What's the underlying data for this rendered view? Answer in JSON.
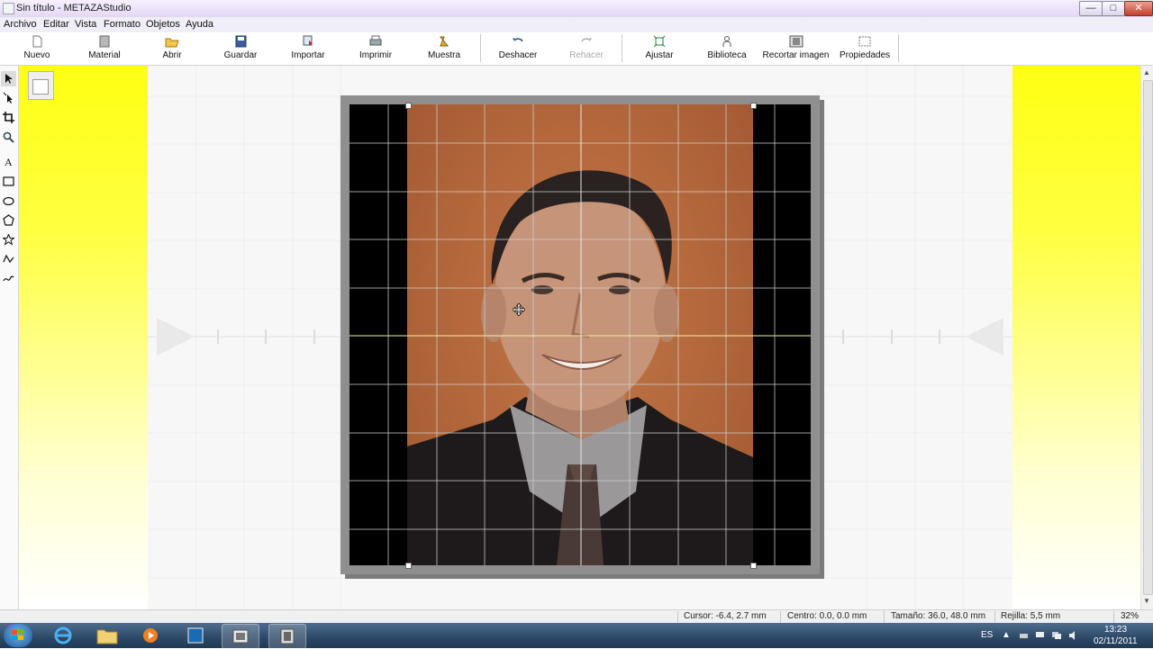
{
  "window": {
    "title": "Sin título - METAZAStudio",
    "min": "—",
    "max": "□",
    "close": "✕"
  },
  "menu": [
    "Archivo",
    "Editar",
    "Vista",
    "Formato",
    "Objetos",
    "Ayuda"
  ],
  "toolbar": {
    "nuevo": "Nuevo",
    "material": "Material",
    "abrir": "Abrir",
    "guardar": "Guardar",
    "importar": "Importar",
    "imprimir": "Imprimir",
    "muestra": "Muestra",
    "deshacer": "Deshacer",
    "rehacer": "Rehacer",
    "ajustar": "Ajustar",
    "biblioteca": "Biblioteca",
    "recortar": "Recortar imagen",
    "propiedades": "Propiedades"
  },
  "tools": [
    "select-arrow-icon",
    "node-edit-icon",
    "crop-icon",
    "zoom-icon",
    "text-icon",
    "rectangle-icon",
    "ellipse-icon",
    "polygon-icon",
    "star-icon",
    "polyline-icon",
    "curve-icon"
  ],
  "status": {
    "cursor": "Cursor: -6.4, 2.7 mm",
    "centro": "Centro: 0.0, 0.0 mm",
    "tamano": "Tamaño: 36.0, 48.0 mm",
    "rejilla": "Rejilla: 5,5 mm",
    "zoom": "32%"
  },
  "taskbar": {
    "language": "ES",
    "time": "13:23",
    "date": "02/11/2011"
  },
  "colors": {
    "workspace_yellow": "#ffff14",
    "photo_background": "#b4683c",
    "taskbar": "#2c4866"
  }
}
